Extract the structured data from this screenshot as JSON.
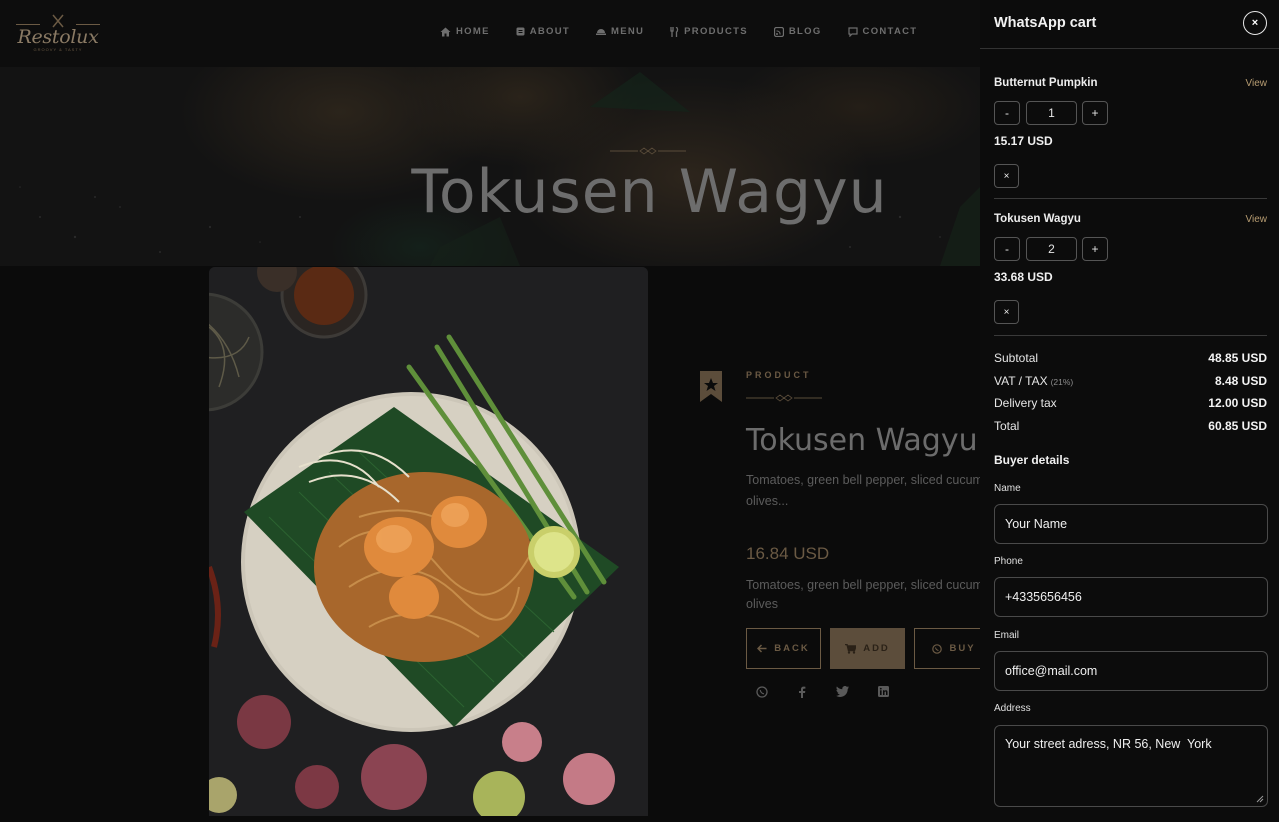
{
  "nav": {
    "logo_text": "Restolux",
    "logo_sub": "GROOVY & TASTY",
    "items": [
      {
        "label": "HOME",
        "icon": "home-icon"
      },
      {
        "label": "ABOUT",
        "icon": "info-icon"
      },
      {
        "label": "MENU",
        "icon": "menu-dish-icon"
      },
      {
        "label": "PRODUCTS",
        "icon": "cutlery-icon"
      },
      {
        "label": "BLOG",
        "icon": "blog-icon"
      },
      {
        "label": "CONTACT",
        "icon": "chat-icon"
      }
    ]
  },
  "hero": {
    "title": "Tokusen Wagyu"
  },
  "product": {
    "kicker": "PRODUCT",
    "title": "Tokusen Wagyu",
    "short_desc": "Tomatoes, green bell pepper, sliced cucum olives...",
    "price": "16.84 USD",
    "long_desc": "Tomatoes, green bell pepper, sliced cucum olives",
    "buttons": {
      "back": "BACK",
      "add": "ADD",
      "buy": "BUY"
    },
    "share": [
      "whatsapp-icon",
      "facebook-icon",
      "twitter-icon",
      "linkedin-icon"
    ]
  },
  "cart": {
    "title": "WhatsApp cart",
    "close": "×",
    "view_label": "View",
    "items": [
      {
        "name": "Butternut Pumpkin",
        "qty": "1",
        "price": "15.17 USD"
      },
      {
        "name": "Tokusen Wagyu",
        "qty": "2",
        "price": "33.68 USD"
      }
    ],
    "qty_minus": "-",
    "qty_plus": "+",
    "remove": "×",
    "totals": [
      {
        "label": "Subtotal",
        "note": "",
        "value": "48.85 USD"
      },
      {
        "label": "VAT / TAX",
        "note": "(21%)",
        "value": "8.48 USD"
      },
      {
        "label": "Delivery tax",
        "note": "",
        "value": "12.00 USD"
      },
      {
        "label": "Total",
        "note": "",
        "value": "60.85 USD"
      }
    ],
    "buyer": {
      "title": "Buyer details",
      "name_label": "Name",
      "name_value": "Your Name",
      "phone_label": "Phone",
      "phone_value": "+4335656456",
      "email_label": "Email",
      "email_value": "office@mail.com",
      "address_label": "Address",
      "address_value": "Your street adress, NR 56, New  York"
    }
  },
  "colors": {
    "accent": "#b89d72",
    "accent_dim": "#6b5a44",
    "panel_bg": "#0c0c0c"
  }
}
